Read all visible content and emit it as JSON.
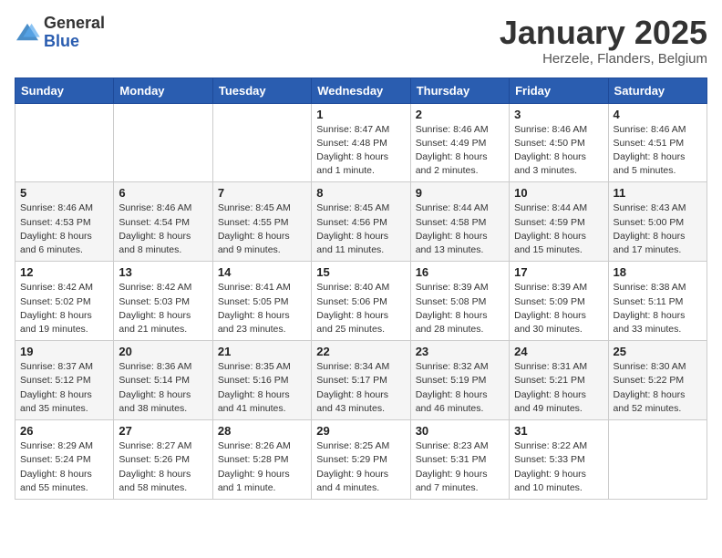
{
  "header": {
    "logo_general": "General",
    "logo_blue": "Blue",
    "month_title": "January 2025",
    "location": "Herzele, Flanders, Belgium"
  },
  "weekdays": [
    "Sunday",
    "Monday",
    "Tuesday",
    "Wednesday",
    "Thursday",
    "Friday",
    "Saturday"
  ],
  "weeks": [
    [
      {
        "day": "",
        "detail": ""
      },
      {
        "day": "",
        "detail": ""
      },
      {
        "day": "",
        "detail": ""
      },
      {
        "day": "1",
        "detail": "Sunrise: 8:47 AM\nSunset: 4:48 PM\nDaylight: 8 hours and 1 minute."
      },
      {
        "day": "2",
        "detail": "Sunrise: 8:46 AM\nSunset: 4:49 PM\nDaylight: 8 hours and 2 minutes."
      },
      {
        "day": "3",
        "detail": "Sunrise: 8:46 AM\nSunset: 4:50 PM\nDaylight: 8 hours and 3 minutes."
      },
      {
        "day": "4",
        "detail": "Sunrise: 8:46 AM\nSunset: 4:51 PM\nDaylight: 8 hours and 5 minutes."
      }
    ],
    [
      {
        "day": "5",
        "detail": "Sunrise: 8:46 AM\nSunset: 4:53 PM\nDaylight: 8 hours and 6 minutes."
      },
      {
        "day": "6",
        "detail": "Sunrise: 8:46 AM\nSunset: 4:54 PM\nDaylight: 8 hours and 8 minutes."
      },
      {
        "day": "7",
        "detail": "Sunrise: 8:45 AM\nSunset: 4:55 PM\nDaylight: 8 hours and 9 minutes."
      },
      {
        "day": "8",
        "detail": "Sunrise: 8:45 AM\nSunset: 4:56 PM\nDaylight: 8 hours and 11 minutes."
      },
      {
        "day": "9",
        "detail": "Sunrise: 8:44 AM\nSunset: 4:58 PM\nDaylight: 8 hours and 13 minutes."
      },
      {
        "day": "10",
        "detail": "Sunrise: 8:44 AM\nSunset: 4:59 PM\nDaylight: 8 hours and 15 minutes."
      },
      {
        "day": "11",
        "detail": "Sunrise: 8:43 AM\nSunset: 5:00 PM\nDaylight: 8 hours and 17 minutes."
      }
    ],
    [
      {
        "day": "12",
        "detail": "Sunrise: 8:42 AM\nSunset: 5:02 PM\nDaylight: 8 hours and 19 minutes."
      },
      {
        "day": "13",
        "detail": "Sunrise: 8:42 AM\nSunset: 5:03 PM\nDaylight: 8 hours and 21 minutes."
      },
      {
        "day": "14",
        "detail": "Sunrise: 8:41 AM\nSunset: 5:05 PM\nDaylight: 8 hours and 23 minutes."
      },
      {
        "day": "15",
        "detail": "Sunrise: 8:40 AM\nSunset: 5:06 PM\nDaylight: 8 hours and 25 minutes."
      },
      {
        "day": "16",
        "detail": "Sunrise: 8:39 AM\nSunset: 5:08 PM\nDaylight: 8 hours and 28 minutes."
      },
      {
        "day": "17",
        "detail": "Sunrise: 8:39 AM\nSunset: 5:09 PM\nDaylight: 8 hours and 30 minutes."
      },
      {
        "day": "18",
        "detail": "Sunrise: 8:38 AM\nSunset: 5:11 PM\nDaylight: 8 hours and 33 minutes."
      }
    ],
    [
      {
        "day": "19",
        "detail": "Sunrise: 8:37 AM\nSunset: 5:12 PM\nDaylight: 8 hours and 35 minutes."
      },
      {
        "day": "20",
        "detail": "Sunrise: 8:36 AM\nSunset: 5:14 PM\nDaylight: 8 hours and 38 minutes."
      },
      {
        "day": "21",
        "detail": "Sunrise: 8:35 AM\nSunset: 5:16 PM\nDaylight: 8 hours and 41 minutes."
      },
      {
        "day": "22",
        "detail": "Sunrise: 8:34 AM\nSunset: 5:17 PM\nDaylight: 8 hours and 43 minutes."
      },
      {
        "day": "23",
        "detail": "Sunrise: 8:32 AM\nSunset: 5:19 PM\nDaylight: 8 hours and 46 minutes."
      },
      {
        "day": "24",
        "detail": "Sunrise: 8:31 AM\nSunset: 5:21 PM\nDaylight: 8 hours and 49 minutes."
      },
      {
        "day": "25",
        "detail": "Sunrise: 8:30 AM\nSunset: 5:22 PM\nDaylight: 8 hours and 52 minutes."
      }
    ],
    [
      {
        "day": "26",
        "detail": "Sunrise: 8:29 AM\nSunset: 5:24 PM\nDaylight: 8 hours and 55 minutes."
      },
      {
        "day": "27",
        "detail": "Sunrise: 8:27 AM\nSunset: 5:26 PM\nDaylight: 8 hours and 58 minutes."
      },
      {
        "day": "28",
        "detail": "Sunrise: 8:26 AM\nSunset: 5:28 PM\nDaylight: 9 hours and 1 minute."
      },
      {
        "day": "29",
        "detail": "Sunrise: 8:25 AM\nSunset: 5:29 PM\nDaylight: 9 hours and 4 minutes."
      },
      {
        "day": "30",
        "detail": "Sunrise: 8:23 AM\nSunset: 5:31 PM\nDaylight: 9 hours and 7 minutes."
      },
      {
        "day": "31",
        "detail": "Sunrise: 8:22 AM\nSunset: 5:33 PM\nDaylight: 9 hours and 10 minutes."
      },
      {
        "day": "",
        "detail": ""
      }
    ]
  ]
}
